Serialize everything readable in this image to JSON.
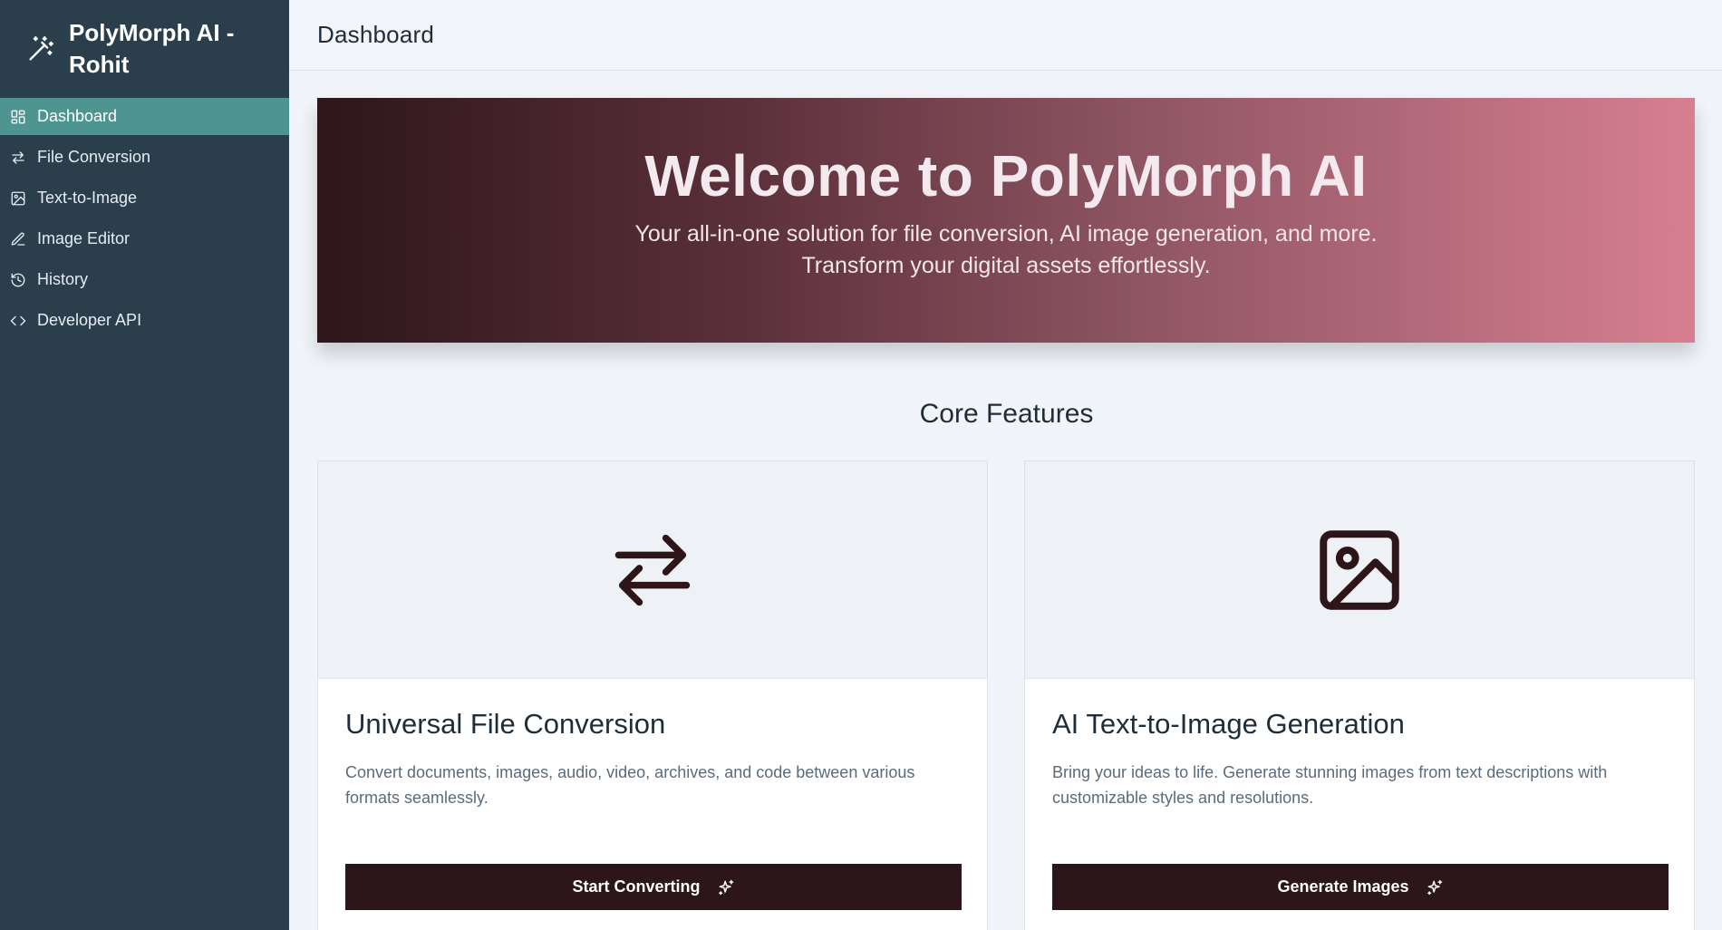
{
  "brand": {
    "title": "PolyMorph AI - Rohit",
    "icon": "magic-wand-icon"
  },
  "sidebar": {
    "items": [
      {
        "label": "Dashboard",
        "icon": "dashboard-icon",
        "active": true
      },
      {
        "label": "File Conversion",
        "icon": "swap-arrows-icon"
      },
      {
        "label": "Text-to-Image",
        "icon": "image-icon"
      },
      {
        "label": "Image Editor",
        "icon": "pen-icon"
      },
      {
        "label": "History",
        "icon": "history-icon"
      },
      {
        "label": "Developer API",
        "icon": "code-icon"
      }
    ]
  },
  "header": {
    "title": "Dashboard"
  },
  "hero": {
    "title": "Welcome to PolyMorph AI",
    "subtitle": "Your all-in-one solution for file conversion, AI image generation, and more. Transform your digital assets effortlessly."
  },
  "features": {
    "title": "Core Features",
    "cards": [
      {
        "icon": "swap-arrows-icon",
        "title": "Universal File Conversion",
        "description": "Convert documents, images, audio, video, archives, and code between various formats seamlessly.",
        "button": "Start Converting"
      },
      {
        "icon": "image-icon",
        "title": "AI Text-to-Image Generation",
        "description": "Bring your ideas to life. Generate stunning images from text descriptions with customizable styles and resolutions.",
        "button": "Generate Images"
      }
    ]
  },
  "colors": {
    "sidebar_bg": "#2b3e4c",
    "active_item": "#4e9591",
    "button_bg": "#2c161a",
    "hero_gradient_start": "#2d161a",
    "hero_gradient_end": "#d77f91"
  }
}
